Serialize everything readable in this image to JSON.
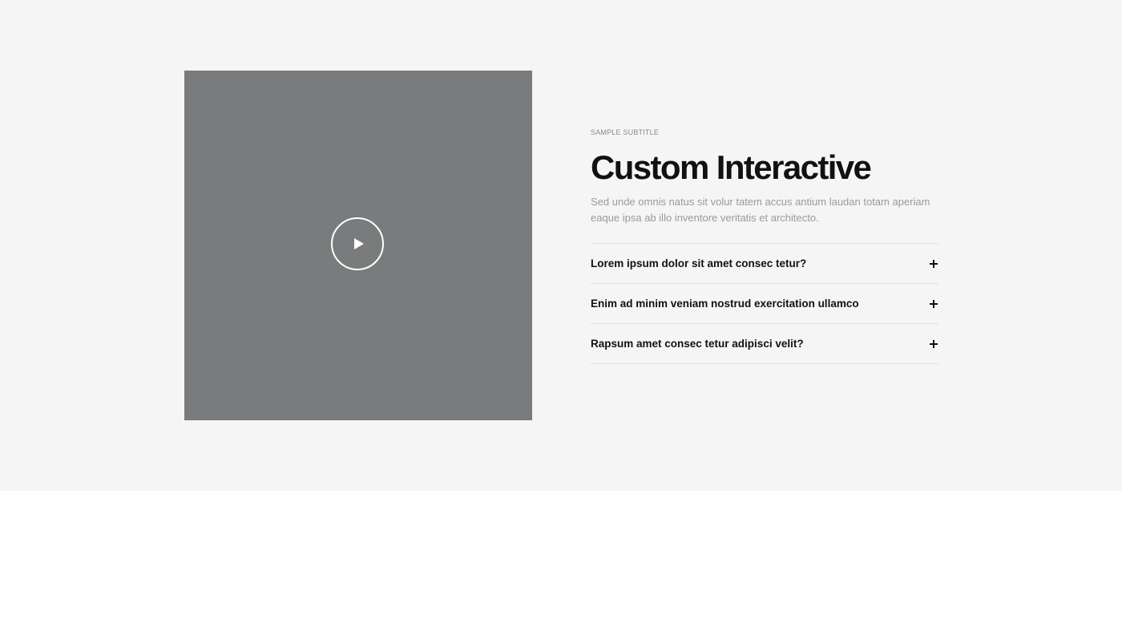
{
  "media": {
    "play_icon": "play-icon"
  },
  "content": {
    "subtitle": "SAMPLE SUBTITLE",
    "title": "Custom Interactive",
    "description": "Sed unde omnis natus sit volur tatem accus antium laudan totam aperiam eaque ipsa ab illo inventore veritatis et architecto."
  },
  "faq": {
    "items": [
      {
        "question": "Lorem ipsum dolor sit amet consec tetur?",
        "icon": "plus-icon"
      },
      {
        "question": "Enim ad minim veniam nostrud exercitation ullamco",
        "icon": "plus-icon"
      },
      {
        "question": "Rapsum amet consec tetur adipisci velit?",
        "icon": "plus-icon"
      }
    ]
  },
  "colors": {
    "section_background": "#f5f5f5",
    "video_placeholder": "#7a7b7c",
    "heading": "#111111",
    "muted_text": "#9a9a9a",
    "divider": "#dedede"
  }
}
